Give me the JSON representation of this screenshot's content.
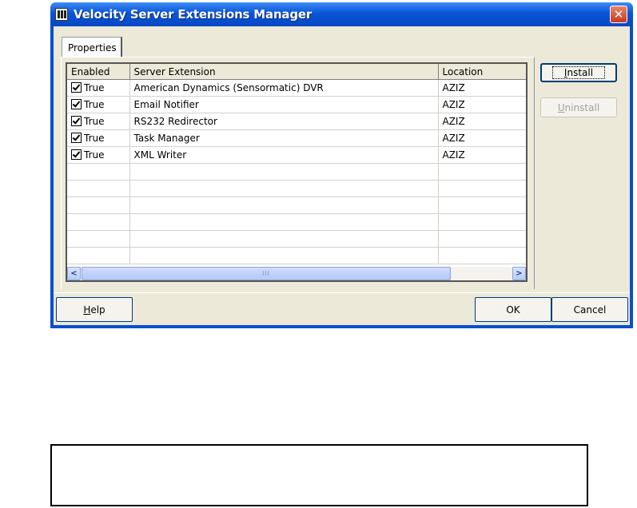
{
  "window": {
    "title": "Velocity Server Extensions Manager",
    "close_glyph": "✕"
  },
  "tabs": [
    {
      "label": "Properties"
    }
  ],
  "grid": {
    "columns": [
      "Enabled",
      "Server Extension",
      "Location"
    ],
    "rows": [
      {
        "enabled": "True",
        "extension": "American Dynamics (Sensormatic) DVR",
        "location": "AZIZ"
      },
      {
        "enabled": "True",
        "extension": "Email Notifier",
        "location": "AZIZ"
      },
      {
        "enabled": "True",
        "extension": "RS232 Redirector",
        "location": "AZIZ"
      },
      {
        "enabled": "True",
        "extension": "Task Manager",
        "location": "AZIZ"
      },
      {
        "enabled": "True",
        "extension": "XML Writer",
        "location": "AZIZ"
      }
    ],
    "empty_rows": 6
  },
  "buttons": {
    "install": {
      "label_access": "I",
      "label_rest": "nstall"
    },
    "uninstall": {
      "label_access": "U",
      "label_rest": "ninstall"
    },
    "help": {
      "label_access": "H",
      "label_rest": "elp"
    },
    "ok": "OK",
    "cancel": "Cancel"
  },
  "scrollbar": {
    "left_arrow": "<",
    "right_arrow": ">",
    "grip": "III"
  },
  "colors": {
    "titlebar": "#0a54d8",
    "dialog_face": "#ece9d8",
    "close_button": "#c9391c"
  }
}
